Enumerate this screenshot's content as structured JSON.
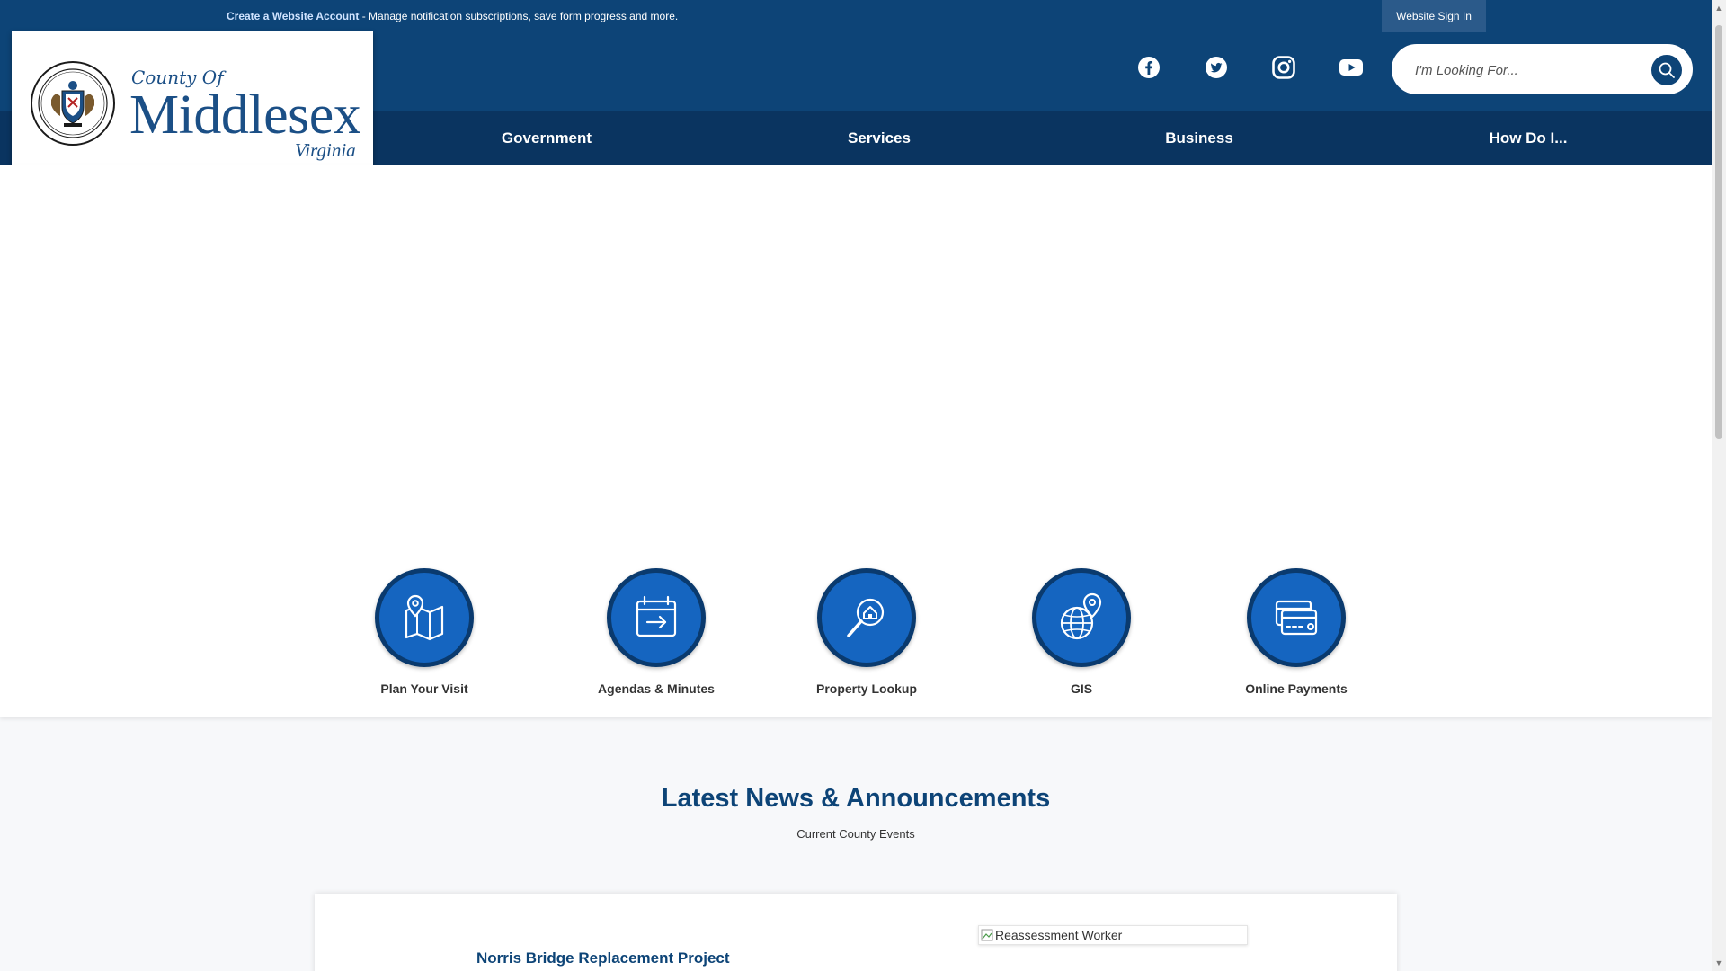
{
  "topbar": {
    "create_account_link": "Create a Website Account",
    "message": " - Manage notification subscriptions, save form progress and more.",
    "signin_label": "Website Sign In"
  },
  "logo": {
    "county_of": "County Of",
    "name": "Middlesex",
    "state": "Virginia"
  },
  "social": [
    "facebook-icon",
    "twitter-icon",
    "instagram-icon",
    "youtube-icon"
  ],
  "search": {
    "placeholder": "I'm Looking For..."
  },
  "nav": {
    "items": [
      {
        "label": "Government"
      },
      {
        "label": "Services"
      },
      {
        "label": "Business"
      },
      {
        "label": "How Do I..."
      }
    ]
  },
  "quick_links": [
    {
      "label": "Plan Your Visit",
      "icon": "map-pin-icon"
    },
    {
      "label": "Agendas & Minutes",
      "icon": "calendar-arrow-icon"
    },
    {
      "label": "Property Lookup",
      "icon": "house-search-icon"
    },
    {
      "label": "GIS",
      "icon": "globe-pin-icon"
    },
    {
      "label": "Online Payments",
      "icon": "credit-card-icon"
    }
  ],
  "news": {
    "title": "Latest News & Announcements",
    "subtitle": "Current County Events",
    "first_headline": "Norris Bridge Replacement Project",
    "image_alt": "Reassessment Worker"
  },
  "colors": {
    "header_blue": "#0d4477",
    "nav_blue": "#0a3460",
    "icon_blue": "#1565c0"
  }
}
